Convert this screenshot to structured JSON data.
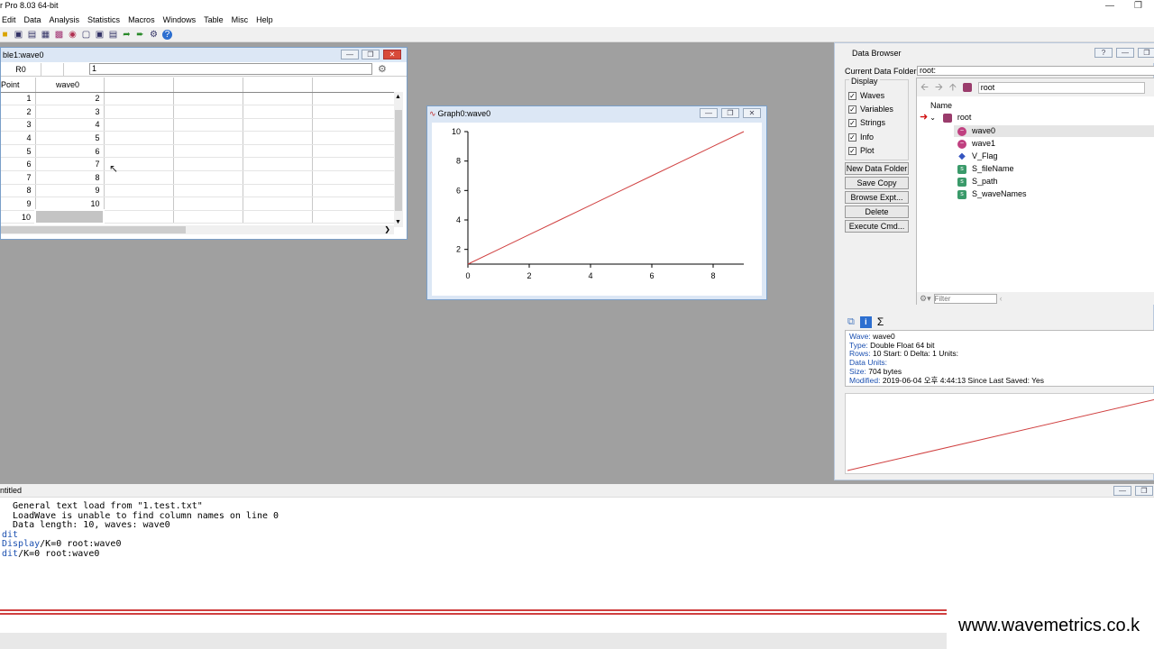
{
  "app": {
    "title": "r Pro 8.03 64-bit"
  },
  "menu": [
    "Edit",
    "Data",
    "Analysis",
    "Statistics",
    "Macros",
    "Windows",
    "Table",
    "Misc",
    "Help"
  ],
  "table": {
    "title": "ble1:wave0",
    "row_label": "R0",
    "entry_value": "1",
    "col_point": "Point",
    "col_wave": "wave0",
    "rows": [
      {
        "point": "1",
        "value": "2"
      },
      {
        "point": "2",
        "value": "3"
      },
      {
        "point": "3",
        "value": "4"
      },
      {
        "point": "4",
        "value": "5"
      },
      {
        "point": "5",
        "value": "6"
      },
      {
        "point": "6",
        "value": "7"
      },
      {
        "point": "7",
        "value": "8"
      },
      {
        "point": "8",
        "value": "9"
      },
      {
        "point": "9",
        "value": "10"
      },
      {
        "point": "10",
        "value": ""
      }
    ]
  },
  "graph": {
    "title": "Graph0:wave0"
  },
  "chart_data": {
    "type": "line",
    "x": [
      0,
      1,
      2,
      3,
      4,
      5,
      6,
      7,
      8,
      9
    ],
    "series": [
      {
        "values": [
          1,
          2,
          3,
          4,
          5,
          6,
          7,
          8,
          9,
          10
        ],
        "color": "#d04040"
      }
    ],
    "xlim": [
      0,
      9
    ],
    "ylim": [
      1,
      10
    ],
    "xticks": [
      0,
      2,
      4,
      6,
      8
    ],
    "yticks": [
      2,
      4,
      6,
      8,
      10
    ],
    "grid": false
  },
  "databrowser": {
    "title": "Data Browser",
    "current_folder_label": "Current Data Folder:",
    "current_folder_value": "root:",
    "display_label": "Display",
    "checks": [
      "Waves",
      "Variables",
      "Strings",
      "Info",
      "Plot"
    ],
    "buttons": [
      "New Data Folder",
      "Save Copy",
      "Browse Expt...",
      "Delete",
      "Execute Cmd..."
    ],
    "path": "root",
    "name_header": "Name",
    "root_label": "root",
    "items": [
      {
        "name": "wave0",
        "type": "wave"
      },
      {
        "name": "wave1",
        "type": "wave"
      },
      {
        "name": "V_Flag",
        "type": "variable"
      },
      {
        "name": "S_fileName",
        "type": "string"
      },
      {
        "name": "S_path",
        "type": "string"
      },
      {
        "name": "S_waveNames",
        "type": "string"
      }
    ],
    "filter_placeholder": "Filter",
    "sigma": "Σ",
    "info_lines": [
      {
        "k": "Wave:",
        "v": " wave0"
      },
      {
        "k": "Type:",
        "v": " Double Float 64 bit"
      },
      {
        "k": "Rows:",
        "v": " 10  Start: 0  Delta: 1  Units:"
      },
      {
        "k": "Data Units:",
        "v": ""
      },
      {
        "k": "Size:",
        "v": " 704 bytes"
      },
      {
        "k": "Modified:",
        "v": "  2019-06-04 오후 4:44:13  Since Last Saved: Yes"
      }
    ]
  },
  "command": {
    "title": "ntitled",
    "lines": [
      {
        "text": "  General text load from \"1.test.txt\"",
        "color": "#000"
      },
      {
        "text": "  LoadWave is unable to find column names on line 0",
        "color": "#000"
      },
      {
        "text": "  Data length: 10, waves: wave0",
        "color": "#000"
      },
      {
        "text": "dit",
        "color": "#1a4fb0"
      },
      {
        "text": "Display/K=0 root:wave0",
        "color": "#000",
        "kw": "Display"
      },
      {
        "text": "dit/K=0 root:wave0",
        "color": "#000",
        "kw": "dit"
      }
    ]
  },
  "watermark": "www.wavemetrics.co.k"
}
